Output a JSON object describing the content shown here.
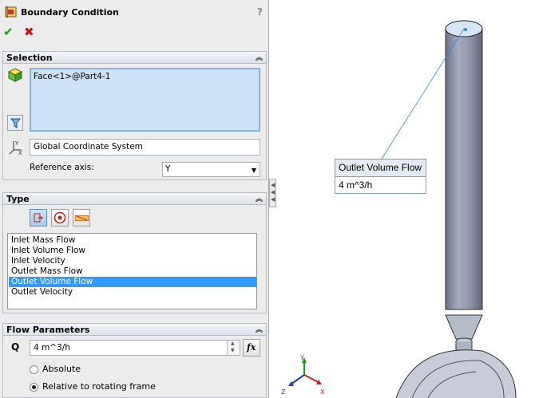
{
  "pm": {
    "title": "Boundary Condition",
    "help_glyph": "?",
    "ok_glyph": "✔",
    "cancel_glyph": "✖"
  },
  "selection": {
    "header": "Selection",
    "face": "Face<1>@Part4-1",
    "coordinate_system": "Global Coordinate System",
    "reference_axis_label": "Reference axis:",
    "reference_axis_value": "Y"
  },
  "type": {
    "header": "Type",
    "items": [
      {
        "label": "Inlet Mass Flow",
        "selected": false
      },
      {
        "label": "Inlet Volume Flow",
        "selected": false
      },
      {
        "label": "Inlet Velocity",
        "selected": false
      },
      {
        "label": "Outlet Mass Flow",
        "selected": false
      },
      {
        "label": "Outlet Volume Flow",
        "selected": true
      },
      {
        "label": "Outlet Velocity",
        "selected": false
      }
    ]
  },
  "flow": {
    "header": "Flow Parameters",
    "q_label": "Q",
    "q_value": "4 m^3/h",
    "fx_label": "fx",
    "absolute_label": "Absolute",
    "relative_label": "Relative to rotating frame",
    "selected_frame": "relative"
  },
  "callout": {
    "title": "Outlet Volume Flow",
    "value": "4 m^3/h"
  },
  "triad": {
    "x": "X",
    "y": "Y",
    "z": "Z"
  },
  "colors": {
    "accent": "#3399ff",
    "pipe": "#8e96aa",
    "ok": "#1a9a1a",
    "cancel": "#d01010"
  }
}
